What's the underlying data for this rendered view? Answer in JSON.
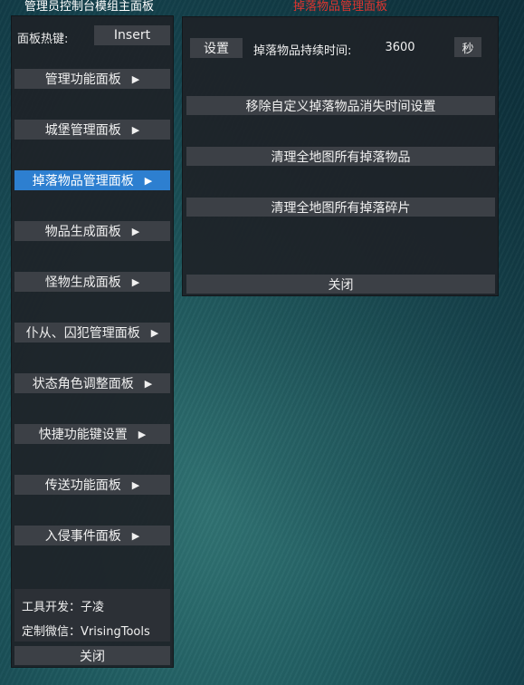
{
  "main_panel": {
    "title": "管理员控制台模组主面板",
    "hotkey_label": "面板热键:",
    "hotkey_value": "Insert",
    "menu": [
      {
        "label": "管理功能面板",
        "arrow": "▶"
      },
      {
        "label": "城堡管理面板",
        "arrow": "▶"
      },
      {
        "label": "掉落物品管理面板",
        "arrow": "▶",
        "active": true
      },
      {
        "label": "物品生成面板",
        "arrow": "▶"
      },
      {
        "label": "怪物生成面板",
        "arrow": "▶"
      },
      {
        "label": "仆从、囚犯管理面板",
        "arrow": "▶"
      },
      {
        "label": "状态角色调整面板",
        "arrow": "▶"
      },
      {
        "label": "快捷功能键设置",
        "arrow": "▶"
      },
      {
        "label": "传送功能面板",
        "arrow": "▶"
      },
      {
        "label": "入侵事件面板",
        "arrow": "▶"
      }
    ],
    "developer": "工具开发：子凌",
    "wechat": "定制微信：VrisingTools",
    "close_label": "关闭"
  },
  "drop_panel": {
    "title": "掉落物品管理面板",
    "set_label": "设置",
    "duration_label": "掉落物品持续时间:",
    "duration_value": "3600",
    "duration_unit": "秒",
    "remove_custom_label": "移除自定义掉落物品消失时间设置",
    "clear_items_label": "清理全地图所有掉落物品",
    "clear_fragments_label": "清理全地图所有掉落碎片",
    "close_label": "关闭"
  },
  "colors": {
    "active_accent": "#2d7fd0",
    "subtitle_red": "#e0352f"
  }
}
